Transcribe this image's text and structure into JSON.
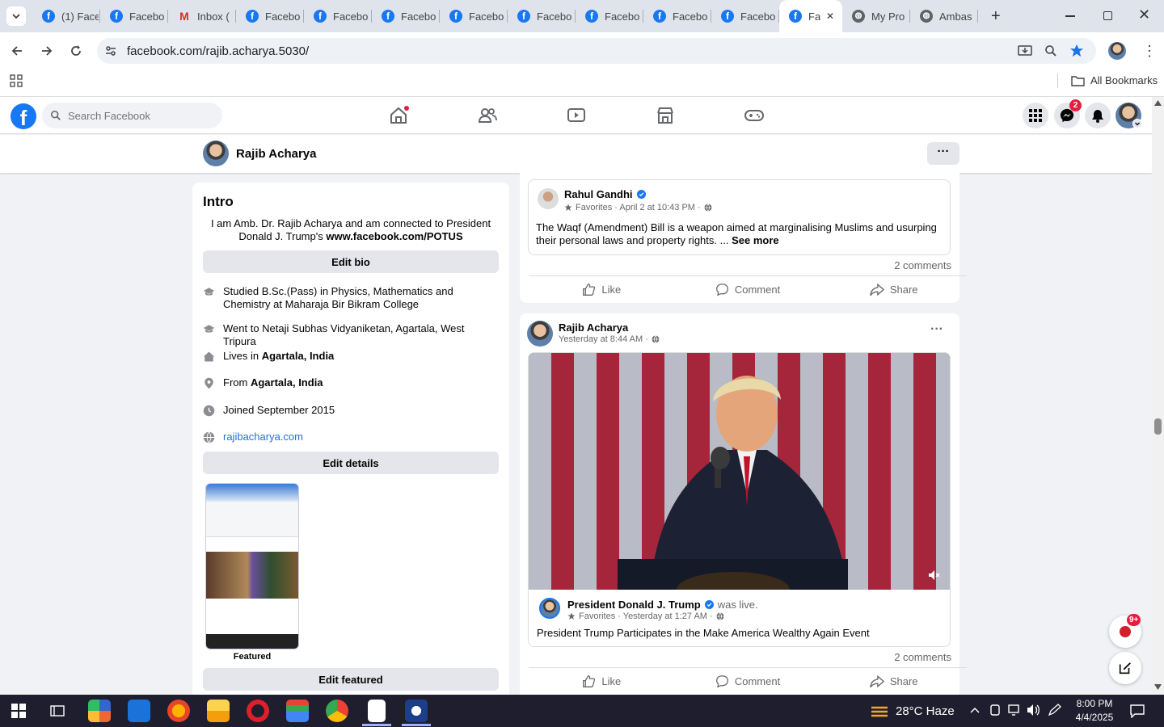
{
  "browser": {
    "tabs": [
      {
        "label": "(1) Face",
        "icon": "facebook-icon"
      },
      {
        "label": "Facebo",
        "icon": "facebook-icon"
      },
      {
        "label": "Inbox (",
        "icon": "gmail-icon"
      },
      {
        "label": "Facebo",
        "icon": "facebook-icon"
      },
      {
        "label": "Facebo",
        "icon": "facebook-icon"
      },
      {
        "label": "Facebo",
        "icon": "facebook-icon"
      },
      {
        "label": "Facebo",
        "icon": "facebook-icon"
      },
      {
        "label": "Facebo",
        "icon": "facebook-icon"
      },
      {
        "label": "Facebo",
        "icon": "facebook-icon"
      },
      {
        "label": "Facebo",
        "icon": "facebook-icon"
      },
      {
        "label": "Facebo",
        "icon": "facebook-icon"
      },
      {
        "label": "Fa",
        "icon": "facebook-icon",
        "active": true
      },
      {
        "label": "My Pro",
        "icon": "globe-icon"
      },
      {
        "label": "Ambas",
        "icon": "globe-icon"
      }
    ],
    "url": "facebook.com/rajib.acharya.5030/",
    "bookmarks_label": "All Bookmarks"
  },
  "facebook": {
    "search_placeholder": "Search Facebook",
    "messenger_badge": "2",
    "profile_name": "Rajib Acharya",
    "more_label": "···"
  },
  "intro": {
    "title": "Intro",
    "bio_line": "I am Amb. Dr. Rajib Acharya and am connected to President Donald J. Trump's",
    "bio_link": "www.facebook.com/POTUS",
    "edit_bio": "Edit bio",
    "studied": "Studied B.Sc.(Pass) in Physics, Mathematics and Chemistry at Maharaja Bir Bikram College",
    "went_to": "Went to Netaji Subhas Vidyaniketan, Agartala, West Tripura",
    "lives_prefix": "Lives in ",
    "lives_place": "Agartala, India",
    "from_prefix": "From ",
    "from_place": "Agartala, India",
    "joined": "Joined September 2015",
    "website": "rajibacharya.com",
    "edit_details": "Edit details",
    "featured_label": "Featured",
    "edit_featured": "Edit featured"
  },
  "post1": {
    "shared_author": "Rahul Gandhi",
    "shared_meta": "Favorites · April 2 at 10:43 PM ·",
    "shared_text": "The Waqf (Amendment) Bill is a weapon aimed at marginalising Muslims and usurping their personal laws and property rights. ...",
    "see_more": "See more",
    "comments": "2 comments",
    "like": "Like",
    "comment": "Comment",
    "share": "Share"
  },
  "post2": {
    "author": "Rajib Acharya",
    "meta": "Yesterday at 8:44 AM ·",
    "shared_author": "President Donald J. Trump",
    "shared_suffix": "was live.",
    "shared_meta": "Favorites · Yesterday at 1:27 AM ·",
    "shared_text": "President Trump Participates in the Make America Wealthy Again Event",
    "comments": "2 comments",
    "like": "Like",
    "comment": "Comment",
    "share": "Share",
    "chat_badge": "9+"
  },
  "taskbar": {
    "weather": "28°C  Haze",
    "time": "8:00 PM",
    "date": "4/4/2025"
  }
}
